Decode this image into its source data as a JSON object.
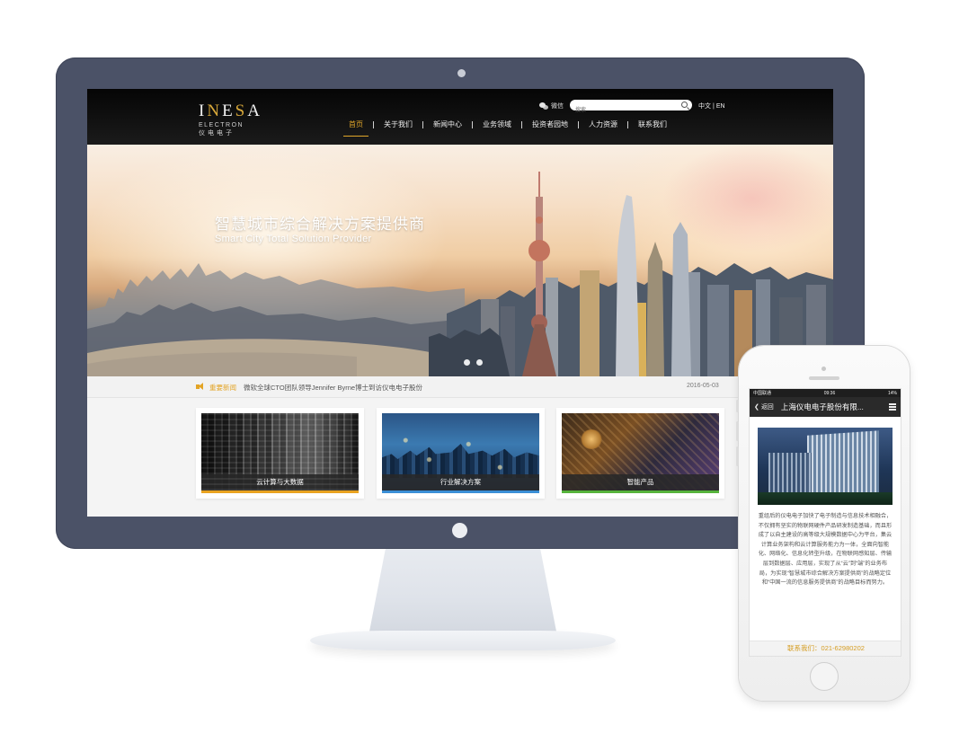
{
  "desktop": {
    "logo": {
      "brand_a": "I",
      "brand_hl": "N",
      "brand_b": "E",
      "brand_hl2": "S",
      "brand_c": "A",
      "sub_en": "ELECTRON",
      "sub_cn": "仪电电子"
    },
    "header": {
      "wechat_label": "微信",
      "search_placeholder": "搜索",
      "lang_cn": "中文",
      "lang_sep": "|",
      "lang_en": "EN"
    },
    "nav": [
      "首页",
      "关于我们",
      "新闻中心",
      "业务领域",
      "投资者园地",
      "人力资源",
      "联系我们"
    ],
    "banner": {
      "title": "智慧城市综合解决方案提供商",
      "subtitle": "Smart City Total Solution Provider",
      "slides": 2
    },
    "news": {
      "label": "重要新闻",
      "text": "微软全球CTO团队领导Jennifer Byrne博士到访仪电电子股份",
      "date": "2016-05-03"
    },
    "cards": [
      {
        "label": "云计算与大数据",
        "accent": "#e9a321"
      },
      {
        "label": "行业解决方案",
        "accent": "#3b8fd6"
      },
      {
        "label": "智能产品",
        "accent": "#56b33c"
      }
    ]
  },
  "phone": {
    "status_carrier": "中国联通",
    "status_time": "09:36",
    "status_battery": "14%",
    "back_label": "返回",
    "title": "上海仪电电子股份有限...",
    "body": "重组后的仪电电子加快了电子制造与信息技术相融合，不仅拥有坚实的物联网硬件产品研发制造基础，而且形成了以自主建设的高等级大规模数据中心为平台，集云计算业务架构和云计算服务能力为一体，全面向智能化、网络化、信息化转型升级，在物联网感知层、传输层到数据层、应用层，实现了从“云”到“端”的业务布局，为实现“智慧城市综合解决方案提供商”的战略定位和“中国一流的信息服务提供商”的战略目标而努力。",
    "contact": "联系我们：021-62980202"
  },
  "colors": {
    "accent": "#e0a62a",
    "monitor_bezel": "#4b5267",
    "header_bg": "#0a0a0a"
  }
}
